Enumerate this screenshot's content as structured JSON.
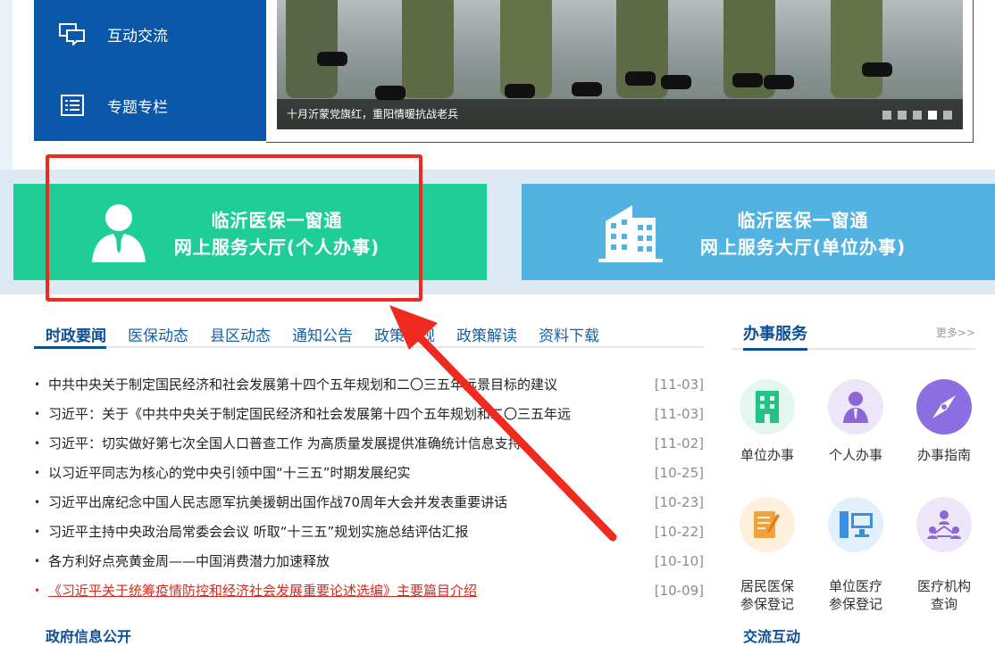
{
  "leftnav": {
    "items": [
      {
        "label": "互动交流",
        "icon": "chat-icon"
      },
      {
        "label": "专题专栏",
        "icon": "list-icon"
      }
    ]
  },
  "slider": {
    "caption": "十月沂蒙党旗红，重阳情暖抗战老兵",
    "dots": 5,
    "active_dot": 4
  },
  "halls": [
    {
      "line1": "临沂医保一窗通",
      "line2": "网上服务大厅(个人办事)",
      "icon": "person-icon",
      "color": "#1ece96"
    },
    {
      "line1": "临沂医保一窗通",
      "line2": "网上服务大厅(单位办事)",
      "icon": "building-icon",
      "color": "#52b3e2"
    }
  ],
  "news": {
    "tabs": [
      "时政要闻",
      "医保动态",
      "县区动态",
      "通知公告",
      "政策法规",
      "政策解读",
      "资料下载"
    ],
    "active_tab": 0,
    "items": [
      {
        "title": "中共中央关于制定国民经济和社会发展第十四个五年规划和二〇三五年远景目标的建议",
        "date": "[11-03]"
      },
      {
        "title": "习近平：关于《中共中央关于制定国民经济和社会发展第十四个五年规划和二〇三五年远",
        "date": "[11-03]"
      },
      {
        "title": "习近平：切实做好第七次全国人口普查工作 为高质量发展提供准确统计信息支持",
        "date": "[11-02]"
      },
      {
        "title": "以习近平同志为核心的党中央引领中国“十三五”时期发展纪实",
        "date": "[10-25]"
      },
      {
        "title": "习近平出席纪念中国人民志愿军抗美援朝出国作战70周年大会并发表重要讲话",
        "date": "[10-23]"
      },
      {
        "title": "习近平主持中央政治局常委会会议 听取“十三五”规划实施总结评估汇报",
        "date": "[10-22]"
      },
      {
        "title": "各方利好点亮黄金周——中国消费潜力加速释放",
        "date": "[10-10]"
      },
      {
        "title": "《习近平关于统筹疫情防控和经济社会发展重要论述选编》主要篇目介绍",
        "date": "[10-09]",
        "highlight": true
      }
    ],
    "next_section": "政府信息公开"
  },
  "services": {
    "title": "办事服务",
    "more": "更多>>",
    "items": [
      {
        "label": "单位办事",
        "icon": "building-icon",
        "color": "#22c28a",
        "bg": "#e3f7ef"
      },
      {
        "label": "个人办事",
        "icon": "person-icon",
        "color": "#8a66d6",
        "bg": "#ece6f8"
      },
      {
        "label": "办事指南",
        "icon": "compass-icon",
        "color": "#7c5ad6",
        "bg": "#8b6ee0"
      },
      {
        "label": "居民医保\n参保登记",
        "icon": "form-icon",
        "color": "#f0a23c",
        "bg": "#fdf0dd"
      },
      {
        "label": "单位医疗\n参保登记",
        "icon": "computer-icon",
        "color": "#3b8fe0",
        "bg": "#e2effc"
      },
      {
        "label": "医疗机构\n查询",
        "icon": "network-icon",
        "color": "#8a66d6",
        "bg": "#ece6f8"
      }
    ],
    "next_section": "交流互动"
  },
  "annotation": {
    "box_color": "#ef2a1e"
  }
}
